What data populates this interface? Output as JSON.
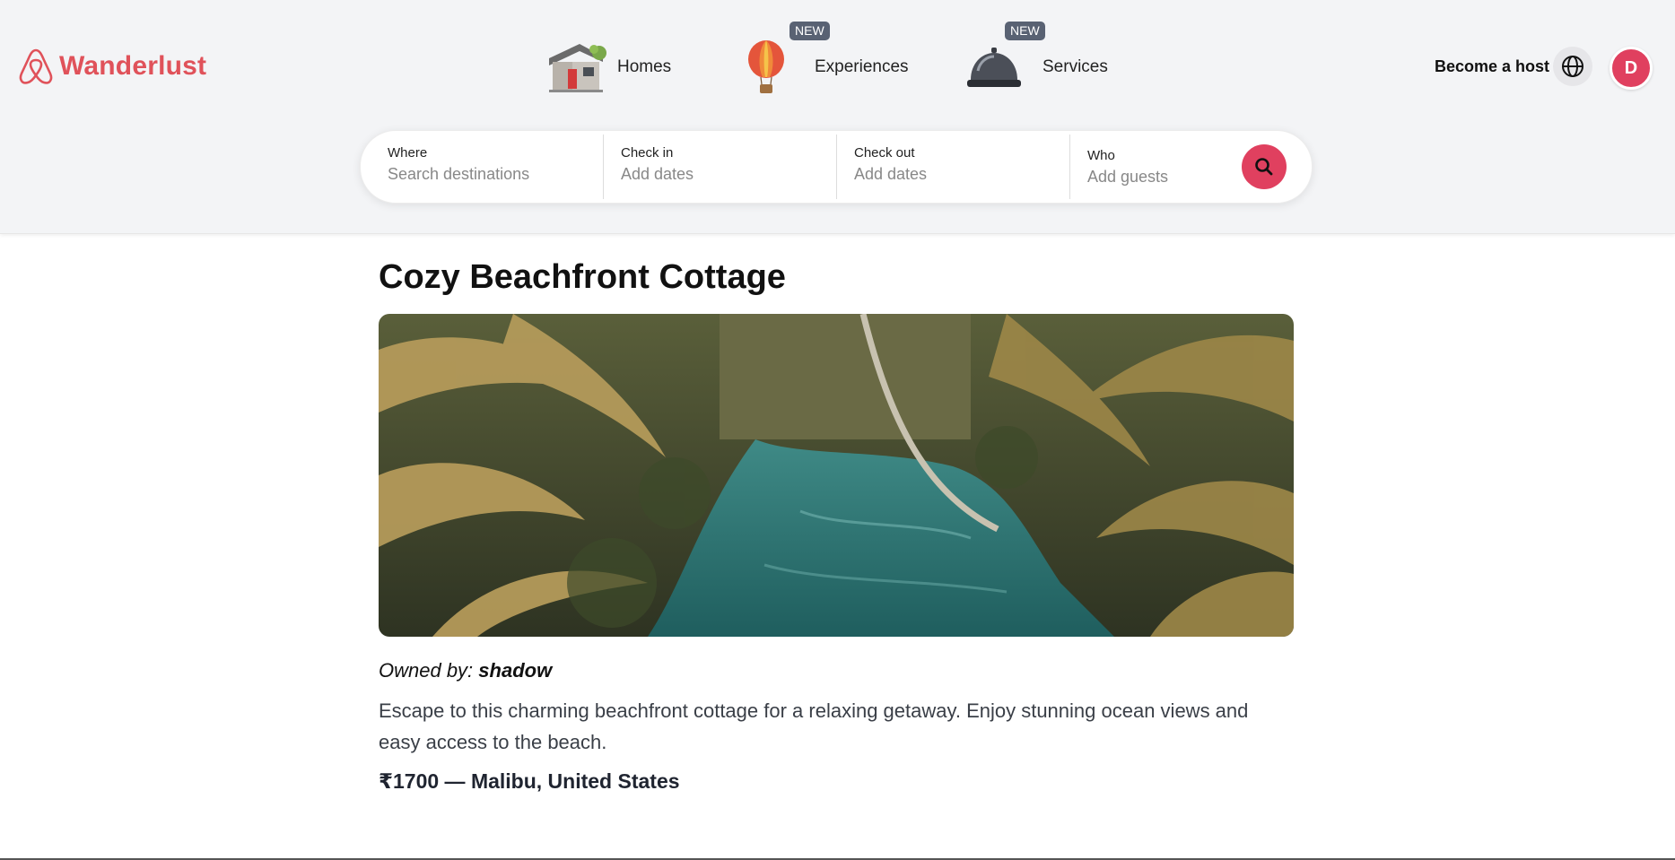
{
  "brand": {
    "name": "Wanderlust",
    "color": "#e0525a"
  },
  "nav": [
    {
      "label": "Homes",
      "icon": "house-icon",
      "badge": ""
    },
    {
      "label": "Experiences",
      "icon": "hot-air-balloon-icon",
      "badge": "NEW"
    },
    {
      "label": "Services",
      "icon": "service-bell-icon",
      "badge": "NEW"
    }
  ],
  "header_right": {
    "become_host": "Become a host",
    "avatar_initial": "D"
  },
  "search": {
    "where_label": "Where",
    "where_placeholder": "Search destinations",
    "checkin_label": "Check in",
    "checkin_placeholder": "Add dates",
    "checkout_label": "Check out",
    "checkout_placeholder": "Add dates",
    "who_label": "Who",
    "who_placeholder": "Add guests"
  },
  "listing": {
    "title": "Cozy Beachfront Cottage",
    "owner_prefix": "Owned by:",
    "owner_name": "shadow",
    "description": "Escape to this charming beachfront cottage for a relaxing getaway. Enjoy stunning ocean views and easy access to the beach.",
    "price_location": "₹1700 — Malibu, United States"
  },
  "colors": {
    "accent": "#e0405f",
    "badge": "#596273",
    "header_bg": "#f3f4f6"
  }
}
